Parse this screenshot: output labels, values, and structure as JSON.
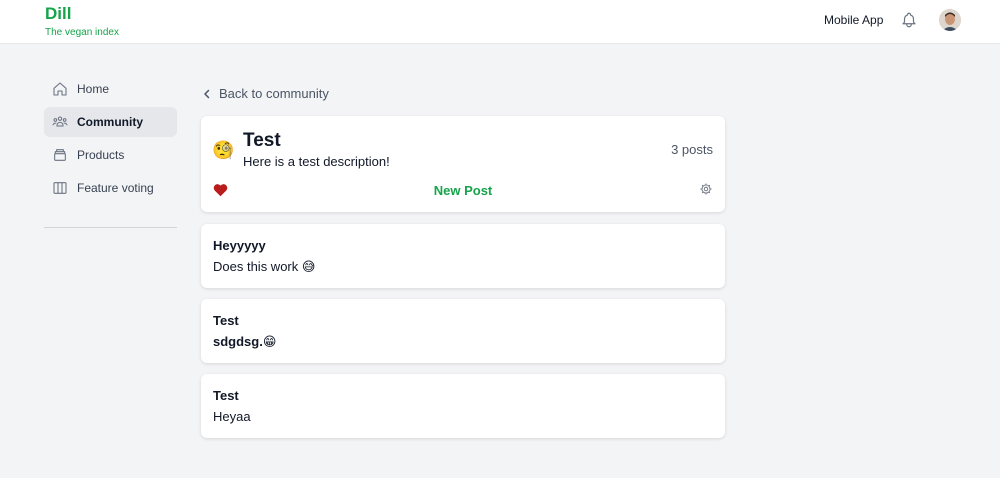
{
  "header": {
    "brand_title": "Dill",
    "brand_subtitle": "The vegan index",
    "mobile_app_label": "Mobile App"
  },
  "sidebar": {
    "items": [
      {
        "label": "Home",
        "icon": "home-icon"
      },
      {
        "label": "Community",
        "icon": "community-icon",
        "active": true
      },
      {
        "label": "Products",
        "icon": "products-icon"
      },
      {
        "label": "Feature voting",
        "icon": "columns-icon"
      }
    ]
  },
  "back_link": {
    "label": "Back to community"
  },
  "community": {
    "emoji": "🧐",
    "title": "Test",
    "description": "Here is a test description!",
    "posts_count": "3 posts",
    "new_post_label": "New Post"
  },
  "posts": [
    {
      "title": "Heyyyyy",
      "body": "Does this work 😅"
    },
    {
      "title": "Test",
      "body": "sdgdsg.😁"
    },
    {
      "title": "Test",
      "body": "Heyaa"
    }
  ],
  "colors": {
    "brand_green": "#16a34a",
    "heart_red": "#b91c1c",
    "background": "#f3f4f6"
  }
}
